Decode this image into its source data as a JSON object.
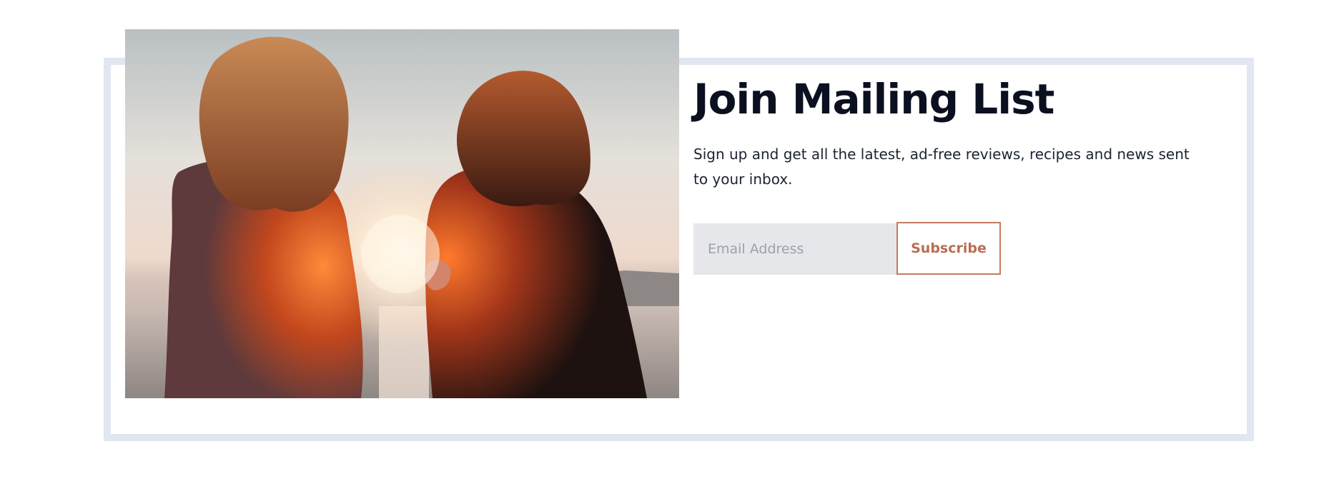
{
  "newsletter": {
    "title": "Join Mailing List",
    "description": "Sign up and get all the latest, ad-free reviews, recipes and news sent to your inbox.",
    "email_placeholder": "Email Address",
    "email_value": "",
    "subscribe_label": "Subscribe",
    "image_alt": "two-women-watching-sunset-over-water"
  },
  "colors": {
    "frame_border": "#e1e7f0",
    "title_text": "#0b1020",
    "body_text": "#1c2330",
    "input_bg": "#e5e7eb",
    "accent": "#c47b5e"
  }
}
